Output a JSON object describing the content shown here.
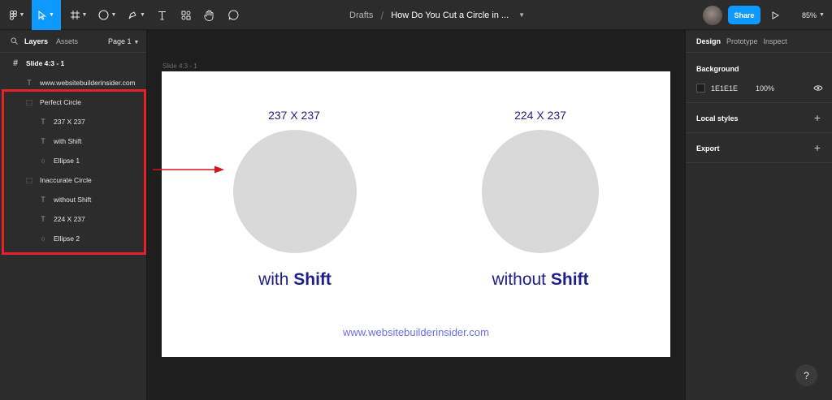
{
  "toolbar": {
    "breadcrumb_root": "Drafts",
    "breadcrumb_sep": "/",
    "file_title": "How Do You Cut a Circle in ...",
    "share_label": "Share",
    "zoom_label": "85%"
  },
  "left_panel": {
    "tab_layers": "Layers",
    "tab_assets": "Assets",
    "page_label": "Page 1",
    "layers": [
      {
        "name": "Slide 4:3 - 1",
        "icon": "frame-icon"
      },
      {
        "name": "www.websitebuilderinsider.com",
        "icon": "text-icon"
      },
      {
        "name": "Perfect Circle",
        "icon": "group-icon"
      },
      {
        "name": "237 X 237",
        "icon": "text-icon"
      },
      {
        "name": "with Shift",
        "icon": "text-icon"
      },
      {
        "name": "Ellipse 1",
        "icon": "ellipse-icon"
      },
      {
        "name": "Inaccurate Circle",
        "icon": "group-icon"
      },
      {
        "name": "without Shift",
        "icon": "text-icon"
      },
      {
        "name": "224 X 237",
        "icon": "text-icon"
      },
      {
        "name": "Ellipse 2",
        "icon": "ellipse-icon"
      }
    ]
  },
  "canvas": {
    "frame_label": "Slide 4:3 - 1",
    "left_dim": "237 X 237",
    "right_dim": "224 X 237",
    "left_caption_pre": "with",
    "left_caption_bold": "Shift",
    "right_caption_pre": "without",
    "right_caption_bold": "Shift",
    "site": "www.websitebuilderinsider.com",
    "circle_color": "#d9d9d9",
    "text_color": "#1d1d8b",
    "highlight_color": "#e8202a"
  },
  "right_panel": {
    "tab_design": "Design",
    "tab_prototype": "Prototype",
    "tab_inspect": "Inspect",
    "background_title": "Background",
    "bg_hex": "1E1E1E",
    "bg_opacity": "100%",
    "local_styles": "Local styles",
    "export": "Export"
  },
  "help_label": "?"
}
